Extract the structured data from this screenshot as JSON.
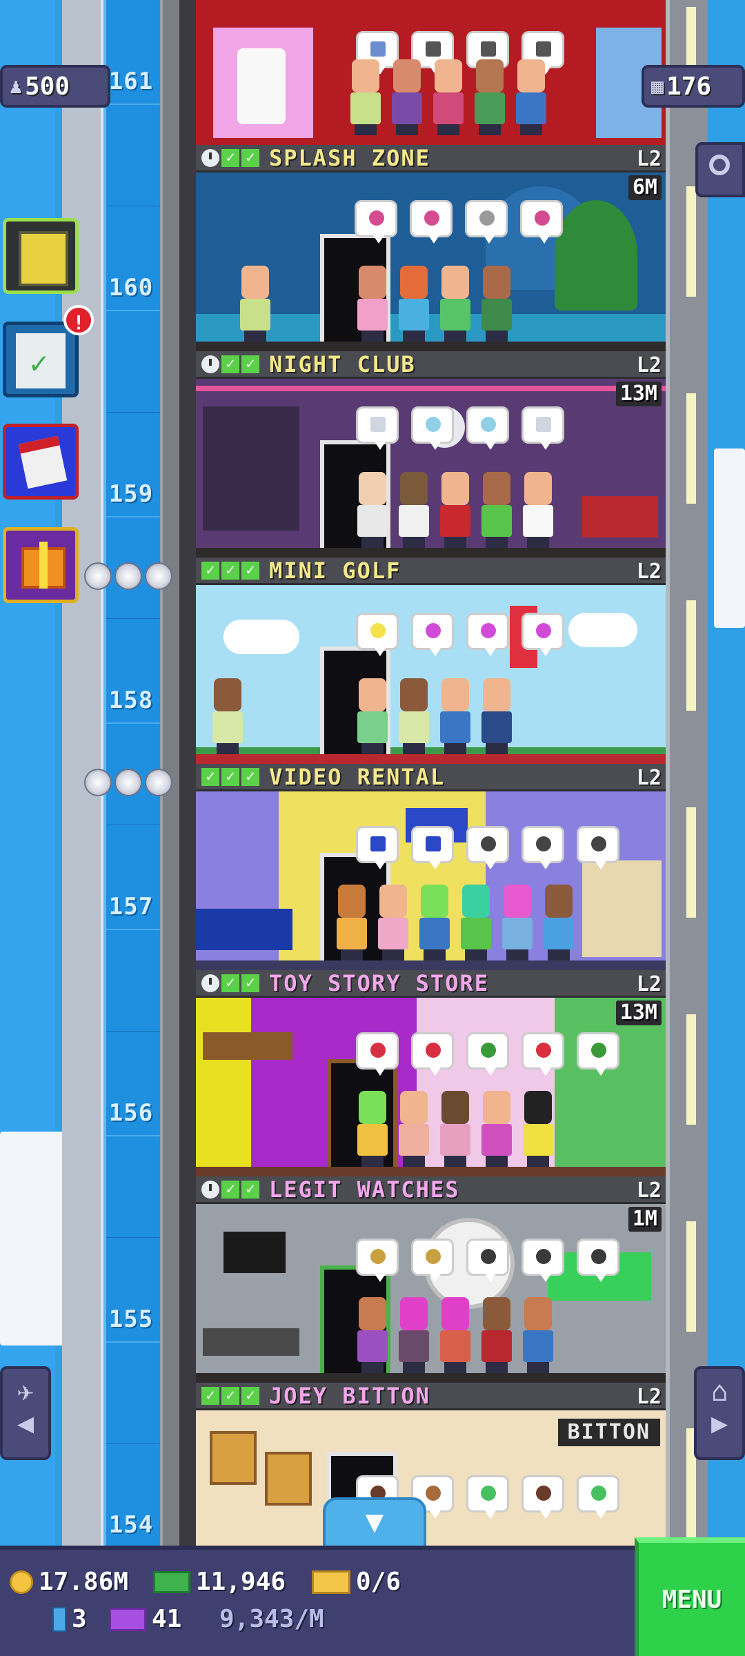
{
  "tower": {
    "population": "500",
    "floors_built": "176"
  },
  "left_menu": {
    "notification_badge": "!"
  },
  "floors": [
    {
      "number": "161",
      "name": "",
      "level": "",
      "money": "",
      "status_icons": []
    },
    {
      "number": "160",
      "name": "SPLASH ZONE",
      "level": "L2",
      "money": "6M",
      "status_icons": [
        "clock",
        "check",
        "check"
      ]
    },
    {
      "number": "159",
      "name": "NIGHT CLUB",
      "level": "L2",
      "money": "13M",
      "status_icons": [
        "clock",
        "check",
        "check"
      ]
    },
    {
      "number": "158",
      "name": "MINI GOLF",
      "level": "L2",
      "money": "",
      "status_icons": [
        "check",
        "check",
        "check"
      ]
    },
    {
      "number": "157",
      "name": "VIDEO RENTAL",
      "level": "L2",
      "money": "",
      "status_icons": [
        "check",
        "check",
        "check"
      ]
    },
    {
      "number": "156",
      "name": "TOY STORY STORE",
      "level": "L2",
      "money": "13M",
      "status_icons": [
        "clock",
        "check",
        "check"
      ]
    },
    {
      "number": "155",
      "name": "LEGIT WATCHES",
      "level": "L2",
      "money": "1M",
      "status_icons": [
        "clock",
        "check",
        "check"
      ]
    },
    {
      "number": "154",
      "name": "JOEY BITTON",
      "level": "L2",
      "money": "",
      "status_icons": [
        "check",
        "check",
        "check"
      ]
    }
  ],
  "joey_sign": "BITTON",
  "bottom_bar": {
    "coins": "17.86M",
    "bux": "11,946",
    "tickets": "0/6",
    "elevators": "3",
    "vip": "41",
    "income_rate": "9,343/M",
    "menu_label": "MENU"
  },
  "colors": {
    "sky": "#2f9fe6",
    "floor_header": "#4a4c52",
    "floor_name_default": "#f4e88a",
    "floor_name_special": "#f3a7ec",
    "menu_green": "#2ed24a",
    "bottom_bar": "#3f4070"
  }
}
